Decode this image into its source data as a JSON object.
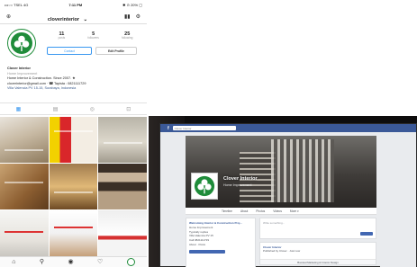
{
  "phone": {
    "status": {
      "carrier": "•••○○ TSEL 4G",
      "time": "7:11 PM",
      "battery": "✱ ⊙ 20% ▢"
    },
    "header": {
      "username": "cloverinterior",
      "chevron": "⌄"
    },
    "stats": [
      {
        "value": "11",
        "label": "posts"
      },
      {
        "value": "5",
        "label": "followers"
      },
      {
        "value": "25",
        "label": "following"
      }
    ],
    "buttons": {
      "contact": "Contact",
      "edit": "Edit Profile"
    },
    "bio": {
      "name": "Clover Interior",
      "category": "Home Improvement",
      "line1": "Home Interior & Construction. Since 2007. ★",
      "line2": "cloverinterior@gmail.com · ☎ Tapista : 0821111729",
      "line3": "Villa Valencia PV 15-15, Surabaya, Indonesia"
    },
    "tabs": [
      "▦",
      "▤",
      "◎",
      "⊡"
    ],
    "nav": [
      "⌂",
      "⚲",
      "◉",
      "♡"
    ]
  },
  "laptop": {
    "search_placeholder": "Clover Interior",
    "page_name": "Clover Interior",
    "page_category": "Home Improvement",
    "tabs": [
      "Timeline",
      "About",
      "Photos",
      "Videos",
      "More ▾"
    ],
    "left": {
      "heading": "Welcoming Interior & Construction Proj...",
      "lines": [
        "Home Improvement",
        "Typically replies",
        "Villa Valencia PV 15",
        "Call 0821111729",
        "About · Posts"
      ]
    },
    "composer_placeholder": "Write something...",
    "post": {
      "name": "Clover Interior",
      "meta": "Published by Clover · Just now",
      "footer": "Boosted Marketing At Interior Design"
    }
  },
  "colors": {
    "instagram_blue": "#3897f0",
    "facebook_blue": "#3b5998",
    "clover_green": "#1f8c3a"
  }
}
